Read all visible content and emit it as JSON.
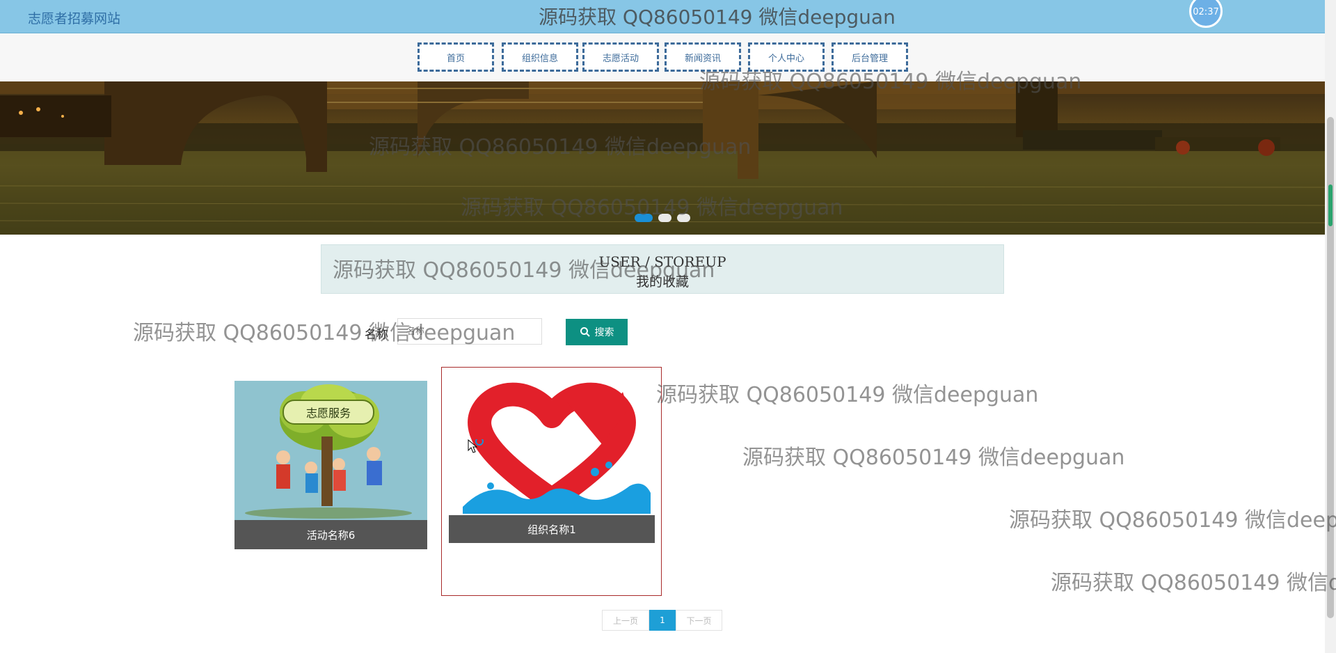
{
  "header": {
    "site_title": "志愿者招募网站",
    "clock": "02:37"
  },
  "nav": {
    "items": [
      {
        "label": "首页"
      },
      {
        "label": "组织信息"
      },
      {
        "label": "志愿活动"
      },
      {
        "label": "新闻资讯"
      },
      {
        "label": "个人中心"
      },
      {
        "label": "后台管理"
      }
    ]
  },
  "banner": {
    "active_slide": 1,
    "slide_count": 3
  },
  "section": {
    "title_en": "USER / STOREUP",
    "title_cn": "我的收藏"
  },
  "search": {
    "label": "名称",
    "placeholder": "名称",
    "button_label": "搜索"
  },
  "cards": [
    {
      "caption": "活动名称6",
      "image_text": "志愿服务"
    },
    {
      "caption": "组织名称1"
    }
  ],
  "pagination": {
    "prev_label": "上一页",
    "current_page": "1",
    "next_label": "下一页"
  },
  "watermark": {
    "text": "源码获取 QQ86050149 微信deepguan"
  },
  "colors": {
    "topbar": "#87c6e6",
    "nav_border": "#3d6b9a",
    "search_button": "#0d9082",
    "caption_bg": "#555555",
    "page_active": "#1e9fd6",
    "heart_red": "#e2202a",
    "water_blue": "#1a9fe0"
  }
}
